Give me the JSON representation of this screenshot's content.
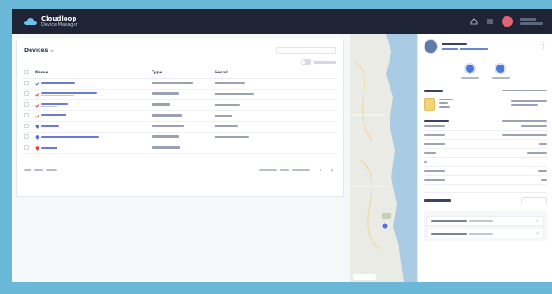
{
  "app": {
    "brand_line1": "Cloudloop",
    "brand_line2": "Device Manager"
  },
  "header": {
    "icons": [
      "home-icon",
      "menu-icon"
    ],
    "user_initials": ""
  },
  "devices": {
    "title": "Devices",
    "search_placeholder": "",
    "columns": [
      "Name",
      "Type",
      "Serial"
    ],
    "status_colors": {
      "blue": "#5a6ee0",
      "red": "#e0474a"
    },
    "rows": [
      {
        "icon": "check-icon",
        "color": "#5a6ee0"
      },
      {
        "icon": "check-icon",
        "color": "#e0474a"
      },
      {
        "icon": "check-icon",
        "color": "#e0474a"
      },
      {
        "icon": "check-icon",
        "color": "#e0474a"
      },
      {
        "icon": "pin-icon",
        "color": "#5a6ee0"
      },
      {
        "icon": "pin-icon",
        "color": "#5a6ee0"
      },
      {
        "icon": "pin-icon",
        "color": "#e0474a"
      }
    ]
  },
  "panel": {
    "actions": [
      "action-one",
      "action-two"
    ]
  },
  "colors": {
    "header_bg": "#1e2335",
    "accent": "#4a79d8",
    "backdrop": "#6ab8d8"
  }
}
